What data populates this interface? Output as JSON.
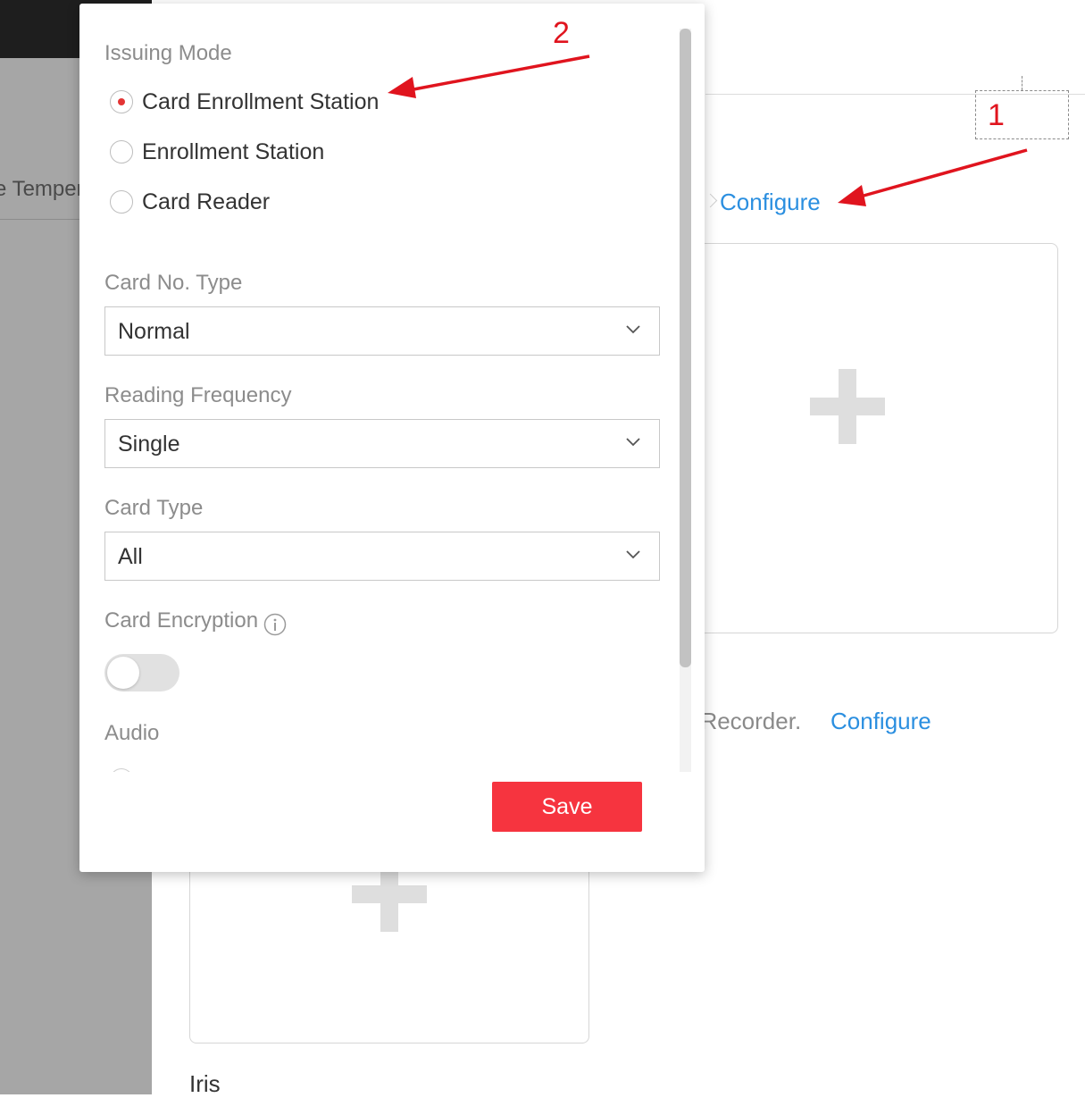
{
  "background": {
    "partial_tab_text": "e Temper",
    "configure_link_1": "Configure",
    "recorder_text": "t Recorder.",
    "configure_link_2": "Configure",
    "iris_label": "Iris"
  },
  "dialog": {
    "issuing_mode": {
      "label": "Issuing Mode",
      "options": [
        {
          "label": "Card Enrollment Station",
          "checked": true
        },
        {
          "label": "Enrollment Station",
          "checked": false
        },
        {
          "label": "Card Reader",
          "checked": false
        }
      ]
    },
    "card_no_type": {
      "label": "Card No. Type",
      "value": "Normal"
    },
    "reading_frequency": {
      "label": "Reading Frequency",
      "value": "Single"
    },
    "card_type": {
      "label": "Card Type",
      "value": "All"
    },
    "card_encryption": {
      "label": "Card Encryption",
      "enabled": false
    },
    "audio": {
      "label": "Audio"
    },
    "save_label": "Save"
  },
  "annotations": {
    "num_1": "1",
    "num_2": "2",
    "color": "#e0141e"
  },
  "colors": {
    "accent_red": "#f6343f",
    "link_blue": "#2b8fe0"
  }
}
